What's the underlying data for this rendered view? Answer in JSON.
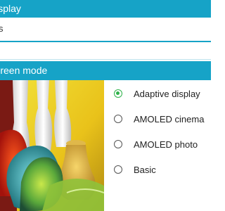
{
  "display_header": "Display",
  "field_value": "s",
  "screen_mode_header": "Screen mode",
  "options": [
    {
      "label": "Adaptive display",
      "checked": true
    },
    {
      "label": "AMOLED cinema",
      "checked": false
    },
    {
      "label": "AMOLED photo",
      "checked": false
    },
    {
      "label": "Basic",
      "checked": false
    }
  ],
  "colors": {
    "accent": "#16a3c7",
    "radio_checked": "#2eb24a"
  }
}
